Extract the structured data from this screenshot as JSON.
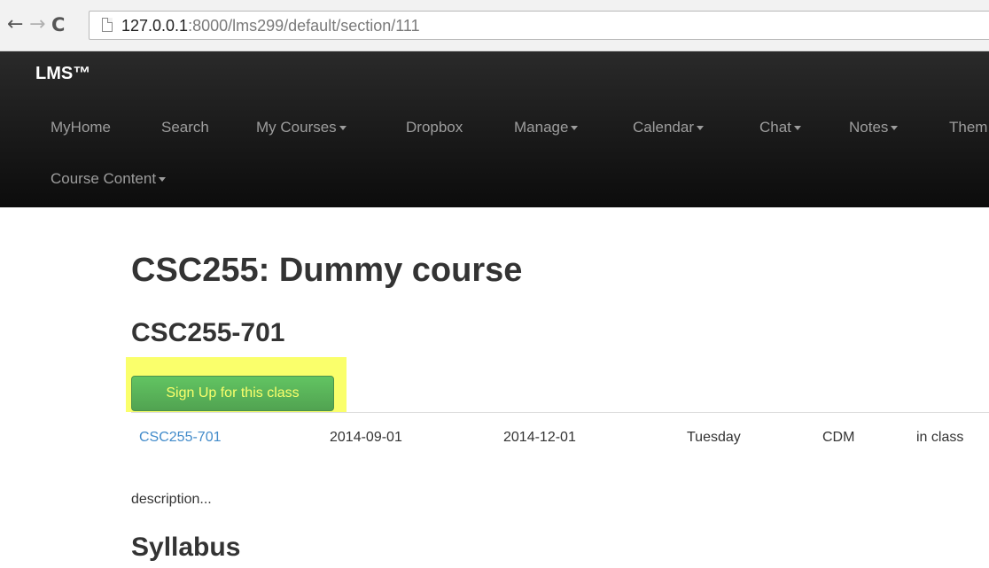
{
  "browser": {
    "back_icon": "←",
    "forward_icon": "→",
    "reload_icon": "C",
    "url_host": "127.0.0.1",
    "url_path": ":8000/lms299/default/section/111"
  },
  "navbar": {
    "brand": "LMS™",
    "items": [
      {
        "label": "MyHome",
        "dropdown": false
      },
      {
        "label": "Search",
        "dropdown": false
      },
      {
        "label": "My Courses",
        "dropdown": true
      },
      {
        "label": "Dropbox",
        "dropdown": false
      },
      {
        "label": "Manage",
        "dropdown": true
      },
      {
        "label": "Calendar",
        "dropdown": true
      },
      {
        "label": "Chat",
        "dropdown": true
      },
      {
        "label": "Notes",
        "dropdown": true
      },
      {
        "label": "Them",
        "dropdown": false
      },
      {
        "label": "Course Content",
        "dropdown": true
      }
    ]
  },
  "course": {
    "title": "CSC255: Dummy course",
    "section_title": "CSC255-701",
    "signup_label": "Sign Up for this class",
    "section_row": {
      "code": "CSC255-701",
      "start_date": "2014-09-01",
      "end_date": "2014-12-01",
      "day": "Tuesday",
      "campus": "CDM",
      "mode": "in class"
    },
    "description": "description...",
    "syllabus_title": "Syllabus"
  },
  "colors": {
    "navbar_bg": "#1b1b1b",
    "nav_text": "#9d9d9d",
    "highlight": "#faff6b",
    "button_green": "#5bb75b",
    "link_blue": "#428bca"
  }
}
